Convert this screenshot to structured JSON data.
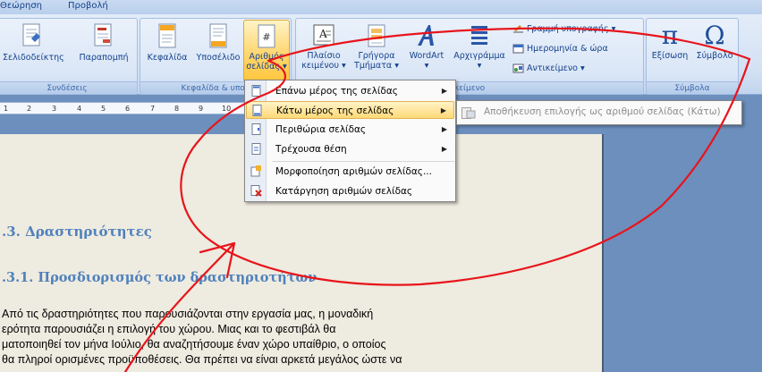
{
  "tabs": [
    "Θεώρηση",
    "Προβολή"
  ],
  "groups": {
    "links": {
      "label": "Συνδέσεις",
      "buttons": [
        {
          "label": "Σελιδοδείκτης",
          "icon": "bookmark-icon"
        },
        {
          "label": "Παραπομπή",
          "icon": "cross-reference-icon"
        }
      ]
    },
    "header_footer": {
      "label": "Κεφαλίδα & υποσ",
      "buttons": [
        {
          "label": "Κεφαλίδα",
          "icon": "header-icon"
        },
        {
          "label": "Υποσέλιδο",
          "icon": "footer-icon"
        },
        {
          "label": "Αριθμός σελίδας",
          "line1": "Αριθμός",
          "line2": "σελίδας",
          "icon": "page-number-icon"
        }
      ]
    },
    "text": {
      "label": "κείμενο",
      "buttons": [
        {
          "line1": "Πλαίσιο",
          "line2": "κειμένου",
          "icon": "text-box-icon"
        },
        {
          "line1": "Γρήγορα",
          "line2": "Τμήματα",
          "icon": "quick-parts-icon"
        },
        {
          "label": "WordArt",
          "icon": "wordart-icon"
        },
        {
          "label": "Αρχιγράμμα",
          "icon": "drop-cap-icon"
        }
      ],
      "small_buttons": [
        {
          "label": "Γραμμή υπογραφής",
          "icon": "signature-line-icon"
        },
        {
          "label": "Ημερομηνία & ώρα",
          "icon": "date-time-icon"
        },
        {
          "label": "Αντικείμενο",
          "icon": "object-icon"
        }
      ]
    },
    "symbols": {
      "label": "Σύμβολα",
      "buttons": [
        {
          "label": "Εξίσωση",
          "glyph": "π",
          "icon": "equation-icon"
        },
        {
          "label": "Σύμβολο",
          "glyph": "Ω",
          "icon": "symbol-icon"
        }
      ]
    }
  },
  "ruler_numbers": [
    "1",
    "2",
    "3",
    "4",
    "5",
    "6",
    "7",
    "8",
    "9",
    "10",
    "11",
    "12",
    "13"
  ],
  "menu": {
    "items": [
      {
        "label": "Επάνω μέρος της σελίδας",
        "submenu": true
      },
      {
        "label": "Κάτω μέρος της σελίδας",
        "submenu": true,
        "highlighted": true
      },
      {
        "label": "Περιθώρια σελίδας",
        "submenu": true
      },
      {
        "label": "Τρέχουσα θέση",
        "submenu": true
      },
      {
        "label": "Μορφοποίηση αριθμών σελίδας...",
        "submenu": false
      },
      {
        "label": "Κατάργηση αριθμών σελίδας",
        "submenu": false
      }
    ],
    "submenu_item": "Αποθήκευση επιλογής ως αριθμού σελίδας (Κάτω)"
  },
  "document": {
    "heading1": ".3.    Δραστηριότητες",
    "heading2": ".3.1. Προσδιορισμός των δραστηριοτήτων",
    "lines": [
      "Από τις δραστηριότητες που παρουσιάζονται στην εργασία μας, η μοναδική",
      "ερότητα παρουσιάζει η επιλογή του χώρου. Μιας και το φεστιβάλ θα",
      "ματοποιηθεί τον μήνα Ιούλιο, θα αναζητήσουμε έναν χώρο υπαίθριο, ο οποίος",
      "θα πληροί ορισμένες προϋποθέσεις. Θα πρέπει να είναι αρκετά μεγάλος ώστε να"
    ]
  },
  "colors": {
    "annotation": "#e8141b",
    "highlight": "#ffd670",
    "heading": "#4f81bd"
  }
}
